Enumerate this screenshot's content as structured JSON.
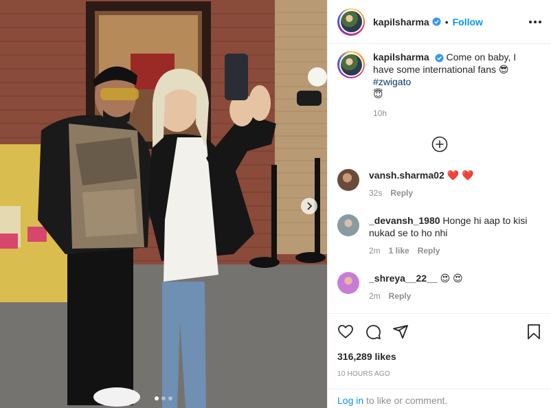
{
  "post": {
    "author": "kapilsharma",
    "follow_label": "Follow",
    "caption_text": "Come on baby, I have some international fans 😎 ",
    "caption_hashtag": "#zwigato",
    "caption_emoji": "😇",
    "caption_time": "10h",
    "likes": "316,289 likes",
    "posted_ago": "10 hours ago",
    "carousel": {
      "slides": 3,
      "active_index": 0
    }
  },
  "comments": [
    {
      "user": "vansh.sharma02",
      "text": "❤️ ❤️",
      "time": "32s",
      "likes": "",
      "reply": "Reply",
      "avatar_color": "#6b4a3a"
    },
    {
      "user": "_devansh_1980",
      "text": "Honge hi aap to kisi nukad se to ho nhi",
      "time": "2m",
      "likes": "1 like",
      "reply": "Reply",
      "avatar_color": "#8a9aa3"
    },
    {
      "user": "_shreya__22__",
      "text": "😍 😍",
      "time": "2m",
      "likes": "",
      "reply": "Reply",
      "avatar_color": "#c77dd8"
    }
  ],
  "login_prompt": {
    "link": "Log in",
    "rest": " to like or comment."
  },
  "icons": {
    "like": "heart-icon",
    "comment": "comment-icon",
    "share": "send-icon",
    "save": "bookmark-icon",
    "more": "more-options-icon",
    "add": "plus-circle-icon",
    "verified": "verified-badge-icon",
    "next": "chevron-right-icon"
  },
  "colors": {
    "accent": "#0095f6",
    "text": "#262626",
    "muted": "#8e8e8e",
    "hashtag": "#00376b",
    "verified": "#3897f0"
  }
}
